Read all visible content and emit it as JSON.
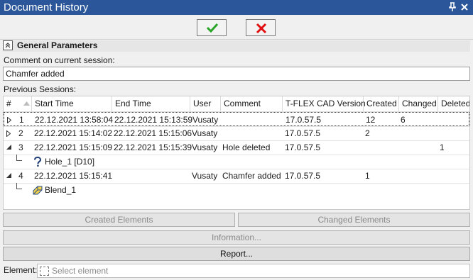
{
  "window": {
    "title": "Document History"
  },
  "toolbar": {
    "ok_icon": "check-icon",
    "cancel_icon": "cross-icon",
    "ok_color": "#2aa52a",
    "cancel_color": "#e01010"
  },
  "section": {
    "title": "General Parameters"
  },
  "comment": {
    "label": "Comment on current session:",
    "value": "Chamfer added"
  },
  "previous": {
    "label": "Previous Sessions:"
  },
  "table": {
    "headers": [
      "#",
      "Start Time",
      "End Time",
      "User",
      "Comment",
      "T-FLEX CAD Version",
      "Created",
      "Changed",
      "Deleted"
    ],
    "rows": [
      {
        "num": "1",
        "start": "22.12.2021 13:58:04",
        "end": "22.12.2021 15:13:59",
        "user": "Vusaty",
        "comment": "",
        "version": "17.0.57.5",
        "created": "12",
        "changed": "6",
        "deleted": "",
        "expanded": false,
        "selected": true
      },
      {
        "num": "2",
        "start": "22.12.2021 15:14:02",
        "end": "22.12.2021 15:15:06",
        "user": "Vusaty",
        "comment": "",
        "version": "17.0.57.5",
        "created": "2",
        "changed": "",
        "deleted": "",
        "expanded": false,
        "selected": false
      },
      {
        "num": "3",
        "start": "22.12.2021 15:15:09",
        "end": "22.12.2021 15:15:39",
        "user": "Vusaty",
        "comment": "Hole deleted",
        "version": "17.0.57.5",
        "created": "",
        "changed": "",
        "deleted": "1",
        "expanded": true,
        "selected": false
      },
      {
        "child": "Hole_1 [D10]",
        "icon": "question-icon"
      },
      {
        "num": "4",
        "start": "22.12.2021 15:15:41",
        "end": "",
        "user": "Vusaty",
        "comment": "Chamfer added",
        "version": "17.0.57.5",
        "created": "1",
        "changed": "",
        "deleted": "",
        "expanded": true,
        "selected": false
      },
      {
        "child": "Blend_1",
        "icon": "blend-icon"
      }
    ]
  },
  "buttons": {
    "created": "Created Elements",
    "changed": "Changed Elements",
    "information": "Information...",
    "report": "Report..."
  },
  "element": {
    "label": "Element:",
    "placeholder": "Select element"
  }
}
